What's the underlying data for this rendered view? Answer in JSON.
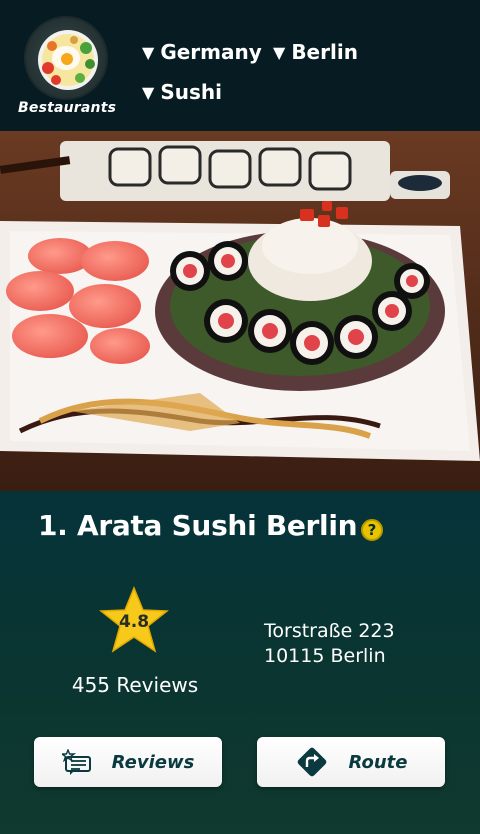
{
  "header": {
    "brand": "Bestaurants",
    "filters": {
      "country": "Germany",
      "city": "Berlin",
      "cuisine": "Sushi"
    },
    "dropdown_glyph": "▼"
  },
  "restaurant": {
    "title": "1. Arata Sushi Berlin",
    "help_glyph": "?",
    "rating": "4.8",
    "reviews_count": "455 Reviews",
    "address_line1": "Torstraße 223",
    "address_line2": "10115 Berlin"
  },
  "actions": {
    "reviews_label": "Reviews",
    "route_label": "Route"
  },
  "colors": {
    "header_bg": "#061c22",
    "panel_bg": "#0a3530",
    "accent_yellow": "#f7c91b",
    "button_text": "#0a3a40"
  },
  "icons": {
    "logo": "food-bowl-logo",
    "help": "question-mark-icon",
    "rating": "star-icon",
    "reviews": "review-list-icon",
    "route": "route-sign-icon"
  }
}
